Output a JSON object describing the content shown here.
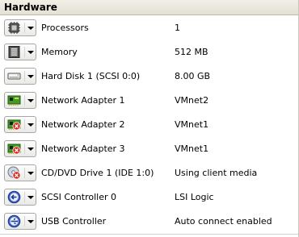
{
  "section": {
    "title": "Hardware"
  },
  "devices": [
    {
      "name": "Processors",
      "value": "1",
      "icon": "processor-icon"
    },
    {
      "name": "Memory",
      "value": "512 MB",
      "icon": "memory-icon"
    },
    {
      "name": "Hard Disk 1 (SCSI 0:0)",
      "value": "8.00 GB",
      "icon": "hard-disk-icon"
    },
    {
      "name": "Network Adapter 1",
      "value": "VMnet2",
      "icon": "network-adapter-icon"
    },
    {
      "name": "Network Adapter 2",
      "value": "VMnet1",
      "icon": "network-adapter-disconnected-icon"
    },
    {
      "name": "Network Adapter 3",
      "value": "VMnet1",
      "icon": "network-adapter-disconnected-icon"
    },
    {
      "name": "CD/DVD Drive 1 (IDE 1:0)",
      "value": "Using client media",
      "icon": "cd-dvd-disconnected-icon"
    },
    {
      "name": "SCSI Controller 0",
      "value": "LSI Logic",
      "icon": "scsi-controller-icon"
    },
    {
      "name": "USB Controller",
      "value": "Auto connect enabled",
      "icon": "usb-controller-icon"
    }
  ],
  "colors": {
    "header_bg": "#e9e7de",
    "chip_green": "#3f9a26",
    "disconnect_red": "#d42a1e",
    "controller_blue": "#3c5fc8"
  }
}
